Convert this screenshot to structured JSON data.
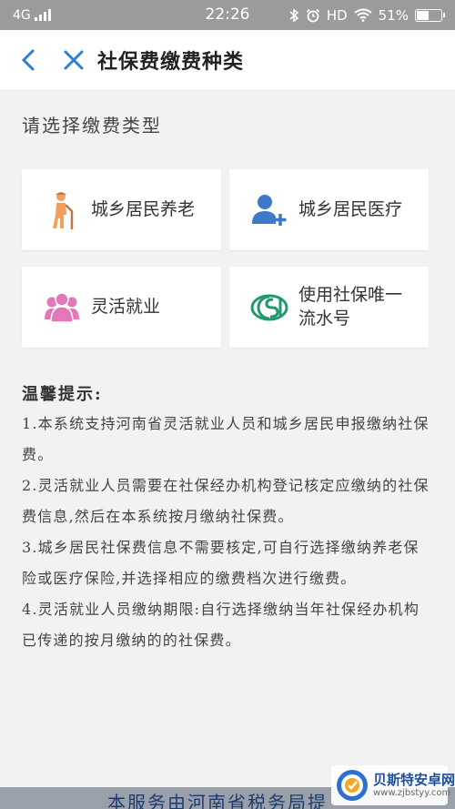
{
  "status_bar": {
    "network": "4G",
    "time": "22:26",
    "hd": "HD",
    "battery_text": "51%",
    "battery_level": 0.51
  },
  "nav": {
    "title": "社保费缴费种类"
  },
  "section_title": "请选择缴费类型",
  "options": [
    {
      "label": "城乡居民养老",
      "icon": "elderly-person-icon"
    },
    {
      "label": "城乡居民医疗",
      "icon": "add-user-icon"
    },
    {
      "label": "灵活就业",
      "icon": "people-group-icon"
    },
    {
      "label": "使用社保唯一流水号",
      "icon": "si-logo-icon"
    }
  ],
  "tips": {
    "title": "温馨提示:",
    "items": [
      "1.本系统支持河南省灵活就业人员和城乡居民申报缴纳社保费。",
      "2.灵活就业人员需要在社保经办机构登记核定应缴纳的社保费信息,然后在本系统按月缴纳社保费。",
      "3.城乡居民社保费信息不需要核定,可自行选择缴纳养老保险或医疗保险,并选择相应的缴费档次进行缴费。",
      "4.灵活就业人员缴纳期限:自行选择缴纳当年社保经办机构已传递的按月缴纳的的社保费。"
    ]
  },
  "footer_text": "本服务由河南省税务局提",
  "watermark": {
    "name": "贝斯特安卓网",
    "url": "www.zjbstyy.com"
  },
  "colors": {
    "accent_blue": "#2b7fd6",
    "elderly_orange": "#f0a05a",
    "user_blue": "#3d78c9",
    "group_pink": "#e377b8",
    "si_green": "#1f9a6b"
  }
}
